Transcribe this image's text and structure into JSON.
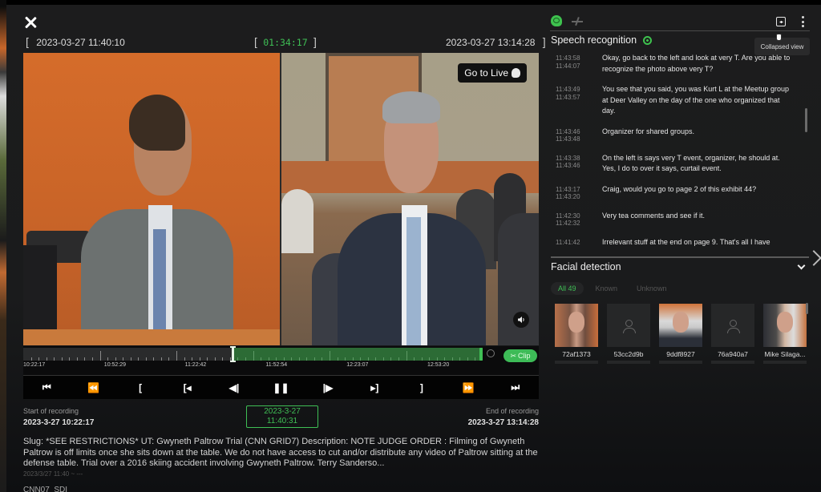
{
  "header": {
    "close_icon": "close-icon",
    "range_start": "2023-03-27 11:40:10",
    "range_duration": "01:34:17",
    "range_end": "2023-03-27 13:14:28",
    "bracket_open": "[",
    "bracket_close": "]"
  },
  "video": {
    "go_live_label": "Go to Live",
    "go_live_icon": "brain-icon",
    "volume_icon": "volume-icon"
  },
  "timeline": {
    "labels": [
      "10:22:17",
      "10:52:29",
      "11:22:42",
      "11:52:54",
      "12:23:07",
      "12:53:20"
    ],
    "playhead_fraction": 0.455,
    "selection_end_fraction": 1.0,
    "zoom_icon": "zoom-icon",
    "clip_label": "Clip",
    "clip_icon": "scissors-icon"
  },
  "controls": [
    {
      "name": "skip-to-start-button",
      "icon": "skip-start-icon",
      "glyph": "⏮"
    },
    {
      "name": "rewind-button",
      "icon": "rewind-icon",
      "glyph": "⏪"
    },
    {
      "name": "mark-in-button",
      "icon": "bracket-open-icon",
      "glyph": "["
    },
    {
      "name": "go-to-mark-in-button",
      "icon": "go-mark-in-icon",
      "glyph": "[◂"
    },
    {
      "name": "step-back-button",
      "icon": "step-back-icon",
      "glyph": "◀|"
    },
    {
      "name": "pause-button",
      "icon": "pause-icon",
      "glyph": "❚❚"
    },
    {
      "name": "step-forward-button",
      "icon": "step-forward-icon",
      "glyph": "|▶"
    },
    {
      "name": "go-to-mark-out-button",
      "icon": "go-mark-out-icon",
      "glyph": "▸]"
    },
    {
      "name": "mark-out-button",
      "icon": "bracket-close-icon",
      "glyph": "]"
    },
    {
      "name": "fast-forward-button",
      "icon": "fast-forward-icon",
      "glyph": "⏩"
    },
    {
      "name": "skip-to-end-button",
      "icon": "skip-end-icon",
      "glyph": "⏭"
    }
  ],
  "recording": {
    "start_label": "Start of recording",
    "start_value": "2023-3-27 10:22:17",
    "current_date": "2023-3-27",
    "current_time": "11:40:31",
    "end_label": "End of recording",
    "end_value": "2023-3-27 13:14:28"
  },
  "description": {
    "text": "Slug: *SEE RESTRICTIONS* UT: Gwyneth Paltrow Trial (CNN GRID7) Description: NOTE JUDGE ORDER : Filming of Gwyneth Paltrow is off limits once she sits down at the table. We do not have access to cut and/or distribute any video of Paltrow sitting at the defense table. Trial over a 2016 skiing accident involving Gwyneth Paltrow. Terry Sanderso...",
    "date": "2023/3/27 11:40 ~ ---",
    "channel": "CNN07_SDI"
  },
  "right_panel": {
    "toolbar": {
      "ai_icon": "brain-icon",
      "split_icon": "split-icon",
      "collapse_icon": "collapse-view-icon",
      "more_icon": "kebab-menu-icon",
      "tooltip": "Collapsed view"
    },
    "speech": {
      "title": "Speech recognition",
      "locate_icon": "target-icon",
      "items": [
        {
          "start": "11:43:58",
          "end": "11:44:07",
          "text": "Okay, go back to the left and look at very T. Are you able to recognize the photo above very T?"
        },
        {
          "start": "11:43:49",
          "end": "11:43:57",
          "text": "You see that you said, you was Kurt L at the Meetup group at Deer Valley on the day of the one who organized that day."
        },
        {
          "start": "11:43:46",
          "end": "11:43:48",
          "text": "Organizer for shared groups."
        },
        {
          "start": "11:43:38",
          "end": "11:43:46",
          "text": "On the left is says very T event, organizer, he should at. Yes, I do to over it says, curtail event."
        },
        {
          "start": "11:43:17",
          "end": "11:43:20",
          "text": "Craig, would you go to page 2 of this exhibit 44?"
        },
        {
          "start": "11:42:30",
          "end": "11:42:32",
          "text": "Very tea comments and see if it."
        },
        {
          "start": "11:41:42",
          "end": "",
          "text": "Irrelevant stuff at the end on page 9. That's all I have"
        }
      ]
    },
    "faces": {
      "title": "Facial detection",
      "tabs": [
        {
          "label": "All 49",
          "active": true
        },
        {
          "label": "Known",
          "active": false
        },
        {
          "label": "Unknown",
          "active": false
        }
      ],
      "items": [
        {
          "name": "72af1373",
          "has_photo": true
        },
        {
          "name": "53cc2d9b",
          "has_photo": false
        },
        {
          "name": "9ddf8927",
          "has_photo": true
        },
        {
          "name": "76a940a7",
          "has_photo": false
        },
        {
          "name": "Mike Silaga...",
          "has_photo": true
        }
      ]
    }
  },
  "colors": {
    "accent_green": "#3fbf55",
    "selection_green": "#2c6b35",
    "background": "#1c1c1d"
  }
}
